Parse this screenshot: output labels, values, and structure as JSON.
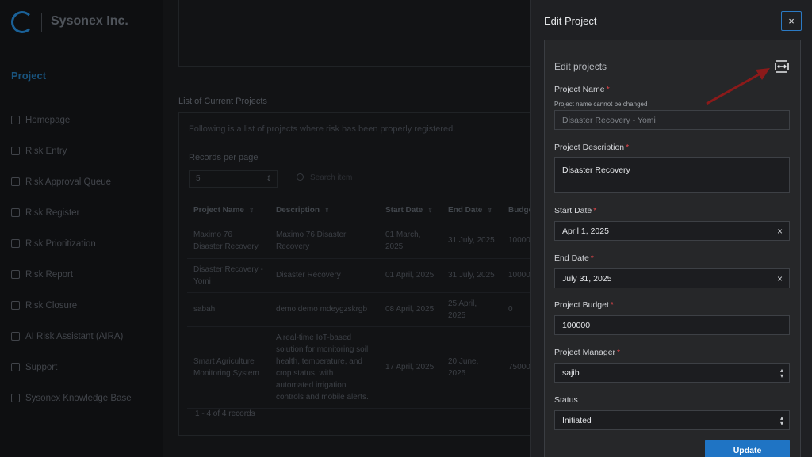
{
  "app": {
    "brand": "Sysonex Inc.",
    "section_title": "Project",
    "nav": [
      {
        "label": "Homepage",
        "icon": "home-icon"
      },
      {
        "label": "Risk Entry",
        "icon": "list-icon"
      },
      {
        "label": "Risk Approval Queue",
        "icon": "queue-icon"
      },
      {
        "label": "Risk Register",
        "icon": "register-icon"
      },
      {
        "label": "Risk Prioritization",
        "icon": "grid-icon"
      },
      {
        "label": "Risk Report",
        "icon": "report-icon"
      },
      {
        "label": "Risk Closure",
        "icon": "closure-icon"
      },
      {
        "label": "AI Risk Assistant (AIRA)",
        "icon": "sliders-icon"
      },
      {
        "label": "Support",
        "icon": "gear-icon"
      },
      {
        "label": "Sysonex Knowledge Base",
        "icon": "book-icon"
      }
    ]
  },
  "projects": {
    "heading": "List of Current Projects",
    "description": "Following is a list of projects where risk has been properly registered.",
    "records_per_page_label": "Records per page",
    "records_per_page_value": "5",
    "search_placeholder": "Search item",
    "columns": [
      "Project Name",
      "Description",
      "Start Date",
      "End Date",
      "Budge"
    ],
    "rows": [
      [
        "Maximo 76 Disaster Recovery",
        "Maximo 76 Disaster Recovery",
        "01 March, 2025",
        "31 July, 2025",
        "10000"
      ],
      [
        "Disaster Recovery - Yomi",
        "Disaster Recovery",
        "01 April, 2025",
        "31 July, 2025",
        "10000"
      ],
      [
        "sabah",
        "demo demo mdeygzskrgb",
        "08 April, 2025",
        "25 April, 2025",
        "0"
      ],
      [
        "Smart Agriculture Monitoring System",
        "A real-time IoT-based solution for monitoring soil health, temperature, and crop status, with automated irrigation controls and mobile alerts.",
        "17 April, 2025",
        "20 June, 2025",
        "75000"
      ]
    ],
    "footer": "1 - 4 of 4 records"
  },
  "drawer": {
    "title": "Edit Project",
    "close_label": "×",
    "panel_title": "Edit projects",
    "project_name_label": "Project Name",
    "project_name_hint": "Project name cannot be changed",
    "project_name_value": "Disaster Recovery - Yomi",
    "description_label": "Project Description",
    "description_value": "Disaster Recovery",
    "start_date_label": "Start Date",
    "start_date_value": "April 1, 2025",
    "end_date_label": "End Date",
    "end_date_value": "July 31, 2025",
    "budget_label": "Project Budget",
    "budget_value": "100000",
    "manager_label": "Project Manager",
    "manager_value": "sajib",
    "status_label": "Status",
    "status_value": "Initiated",
    "update_label": "Update",
    "required_mark": "*",
    "clear_mark": "×"
  },
  "colors": {
    "accent": "#1f74c4",
    "required": "#e0454a",
    "annotation_arrow": "#8b1a1a"
  }
}
